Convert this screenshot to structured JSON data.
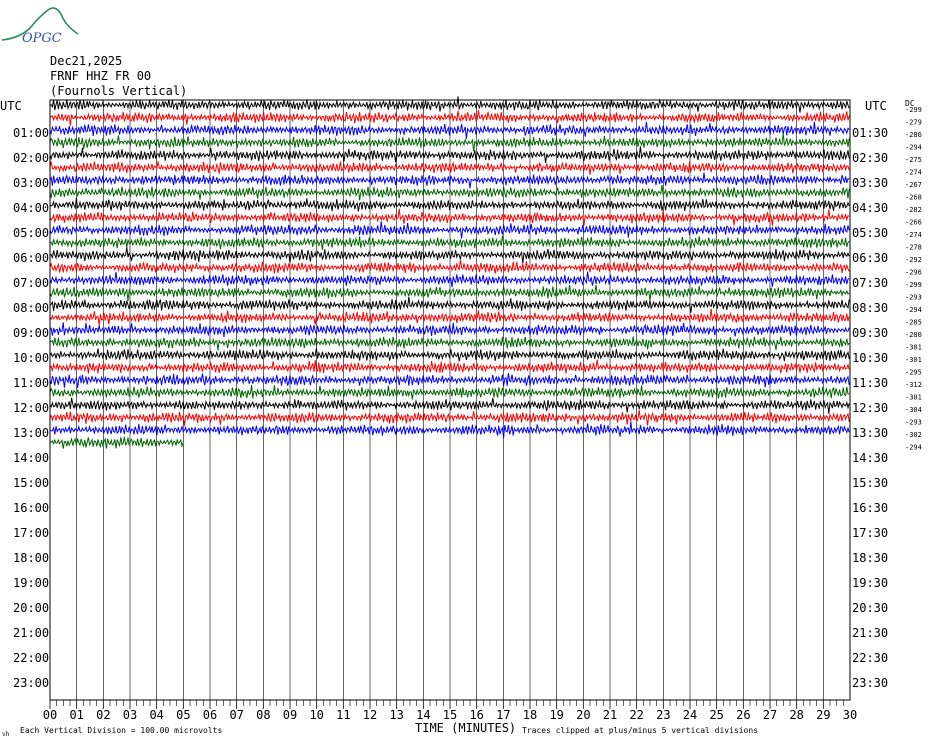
{
  "header": {
    "date": "Dec21,2025",
    "station": "FRNF HHZ FR 00",
    "location": "(Fournols Vertical)",
    "logo_text": "OPGC"
  },
  "axis": {
    "left_title": "UTC",
    "right_title": "UTC",
    "dc_title": "DC",
    "xlabel": "TIME (MINUTES)",
    "footer_left": "Each Vertical Division =  100.00 microvolts",
    "footer_right": "Traces clipped at plus/minus 5 vertical divisions",
    "footer_mark": "vh"
  },
  "chart_data": {
    "type": "line",
    "title": "FRNF HHZ FR 00 (Fournols Vertical) Dec21,2025",
    "xlabel": "TIME (MINUTES)",
    "x_ticks": [
      "00",
      "01",
      "02",
      "03",
      "04",
      "05",
      "06",
      "07",
      "08",
      "09",
      "10",
      "11",
      "12",
      "13",
      "14",
      "15",
      "16",
      "17",
      "18",
      "19",
      "20",
      "21",
      "22",
      "23",
      "24",
      "25",
      "26",
      "27",
      "28",
      "29",
      "30"
    ],
    "xlim": [
      0,
      30
    ],
    "left_hour_labels": [
      "01:00",
      "02:00",
      "03:00",
      "04:00",
      "05:00",
      "06:00",
      "07:00",
      "08:00",
      "09:00",
      "10:00",
      "11:00",
      "12:00",
      "13:00",
      "14:00",
      "15:00",
      "16:00",
      "17:00",
      "18:00",
      "19:00",
      "20:00",
      "21:00",
      "22:00",
      "23:00"
    ],
    "right_hour_labels": [
      "01:30",
      "02:30",
      "03:30",
      "04:30",
      "05:30",
      "06:30",
      "07:30",
      "08:30",
      "09:30",
      "10:30",
      "11:30",
      "12:30",
      "13:30",
      "14:30",
      "15:30",
      "16:30",
      "17:30",
      "18:30",
      "19:30",
      "20:30",
      "21:30",
      "22:30",
      "23:30"
    ],
    "dc_offsets": [
      "-299",
      "-279",
      "-286",
      "-294",
      "-275",
      "-274",
      "-267",
      "-268",
      "-282",
      "-266",
      "-274",
      "-278",
      "-292",
      "-296",
      "-299",
      "-293",
      "-294",
      "-285",
      "-280",
      "-301",
      "-301",
      "-295",
      "-312",
      "-301",
      "-304",
      "-293",
      "-302",
      "-294"
    ],
    "trace_colors": [
      "#000000",
      "#ff0000",
      "#0000ff",
      "#006400"
    ],
    "trace_count": 28,
    "last_trace_minutes": 5,
    "units_per_division_microvolts": 100.0,
    "clip_divisions": 5
  }
}
